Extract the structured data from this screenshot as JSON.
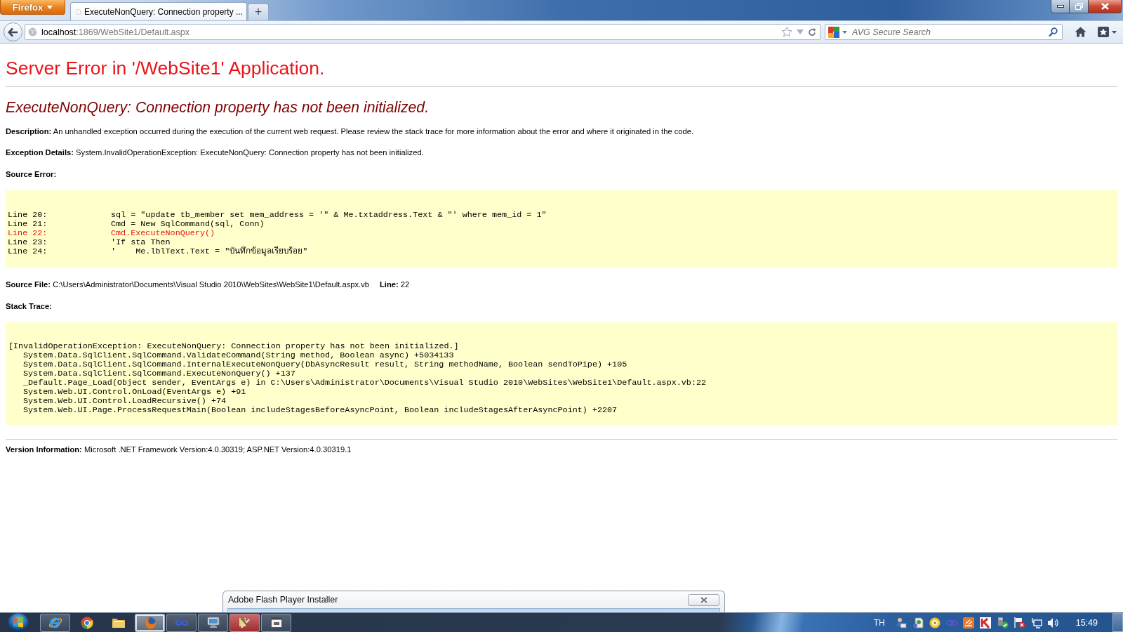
{
  "browser": {
    "menu_button": "Firefox",
    "tabs": [
      {
        "title": "ExecuteNonQuery: Connection property ...",
        "selected": true
      }
    ],
    "new_tab": "+",
    "address": {
      "host": "localhost",
      "rest": ":1869/WebSite1/Default.aspx"
    },
    "search": {
      "placeholder": "AVG Secure Search"
    }
  },
  "page": {
    "title": "Server Error in '/WebSite1' Application.",
    "message": "ExecuteNonQuery: Connection property has not been initialized.",
    "description": "**Description:** An unhandled exception occurred during the execution of the current web request. Please review the stack trace for more information about the error and where it originated in the code.",
    "exception_details": "**Exception Details:** System.InvalidOperationException: ExecuteNonQuery: Connection property has not been initialized.",
    "source_error": {
      "label": "Source Error:",
      "lines": [
        {
          "number": "Line 20:",
          "code": "sql = \"update tb_member set mem_address = '\" & Me.txtaddress.Text & \"' where mem_id = 1\"",
          "highlighted": false
        },
        {
          "number": "Line 21:",
          "code": "Cmd = New SqlCommand(sql, Conn)",
          "highlighted": false
        },
        {
          "number": "Line 22:",
          "code": "Cmd.ExecuteNonQuery()",
          "highlighted": true
        },
        {
          "number": "Line 23:",
          "code": "'If sta Then",
          "highlighted": false
        },
        {
          "number": "Line 24:",
          "code": "'    Me.lblText.Text = \"บันทึกข้อมูลเรียบร้อย\"",
          "highlighted": false
        }
      ]
    },
    "source_file": "**Source File:** C:\\Users\\Administrator\\Documents\\Visual Studio 2010\\WebSites\\WebSite1\\Default.aspx.vb",
    "source_line": "**Line:** 22",
    "stack_trace": {
      "label": "Stack Trace:",
      "exception": "[InvalidOperationException: ExecuteNonQuery: Connection property has not been initialized.]",
      "frames": [
        "System.Data.SqlClient.SqlCommand.ValidateCommand(String method, Boolean async) +5034133",
        "System.Data.SqlClient.SqlCommand.InternalExecuteNonQuery(DbAsyncResult result, String methodName, Boolean sendToPipe) +105",
        "System.Data.SqlClient.SqlCommand.ExecuteNonQuery() +137",
        "_Default.Page_Load(Object sender, EventArgs e) in C:\\Users\\Administrator\\Documents\\Visual Studio 2010\\WebSites\\WebSite1\\Default.aspx.vb:22",
        "System.Web.UI.Control.OnLoad(EventArgs e) +91",
        "System.Web.UI.Control.LoadRecursive() +74",
        "System.Web.UI.Page.ProcessRequestMain(Boolean includeStagesBeforeAsyncPoint, Boolean includeStagesAfterAsyncPoint) +2207"
      ]
    },
    "version": "**Version Information:** Microsoft .NET Framework Version:4.0.30319; ASP.NET Version:4.0.30319.1"
  },
  "installer_window": {
    "title": "Adobe Flash Player Installer"
  },
  "taskbar": {
    "apps": [
      {
        "kind": "ie",
        "running": true,
        "selected": false,
        "flashing": false
      },
      {
        "kind": "chrome",
        "running": false,
        "selected": false,
        "flashing": false
      },
      {
        "kind": "explorer",
        "running": false,
        "selected": false,
        "flashing": false
      },
      {
        "kind": "firefox",
        "running": true,
        "selected": true,
        "flashing": false
      },
      {
        "kind": "infinity",
        "running": true,
        "selected": false,
        "flashing": false
      },
      {
        "kind": "monitor",
        "running": true,
        "selected": false,
        "flashing": false
      },
      {
        "kind": "tools",
        "running": true,
        "selected": false,
        "flashing": true
      },
      {
        "kind": "window",
        "running": true,
        "selected": false,
        "flashing": false
      }
    ],
    "language": "TH",
    "tray_icons": [
      {
        "kind": "people"
      },
      {
        "kind": "document"
      },
      {
        "kind": "disc"
      },
      {
        "kind": "chain"
      },
      {
        "kind": "tile"
      },
      {
        "kind": "kmark"
      },
      {
        "kind": "drive"
      },
      {
        "kind": "flag"
      },
      {
        "kind": "network"
      },
      {
        "kind": "volume"
      }
    ],
    "clock": "15:49"
  }
}
